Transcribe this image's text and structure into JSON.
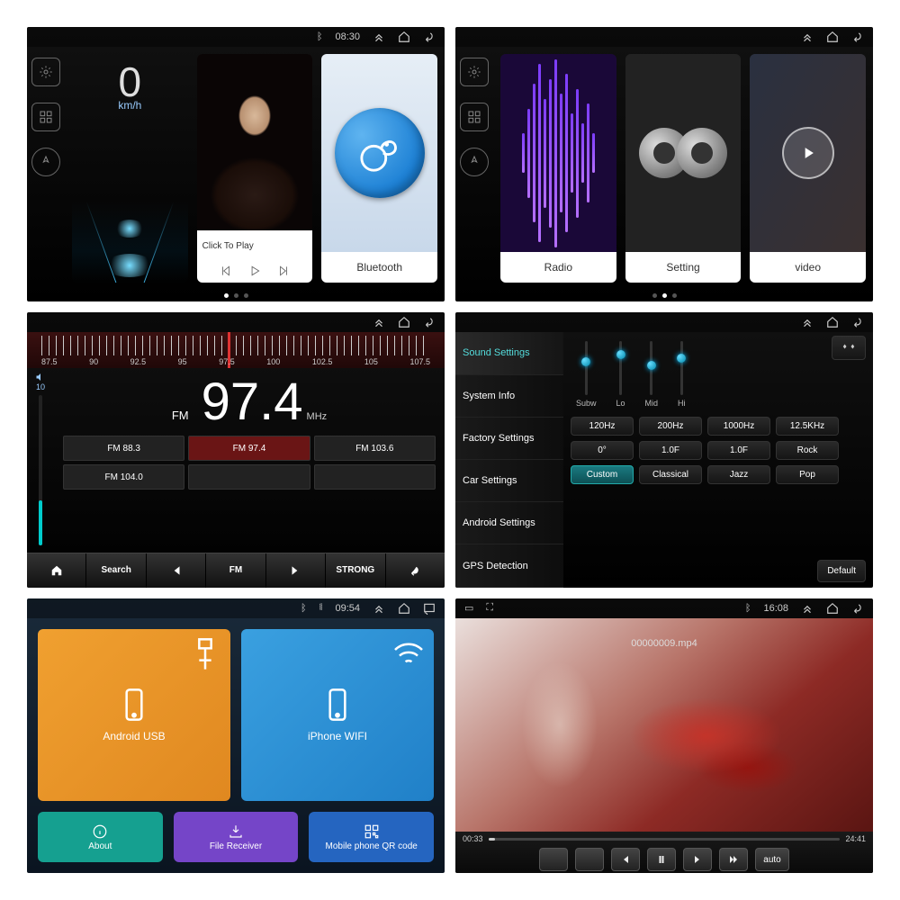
{
  "status": {
    "time1": "08:30",
    "time3": "09:54",
    "time6": "16:08"
  },
  "p1": {
    "speed": "0",
    "unit": "km/h",
    "music_label": "Click To Play",
    "bt_label": "Bluetooth"
  },
  "p2": {
    "radio": "Radio",
    "setting": "Setting",
    "video": "video"
  },
  "p3": {
    "ticks": [
      "87.5",
      "90",
      "92.5",
      "95",
      "97.5",
      "100",
      "102.5",
      "105",
      "107.5"
    ],
    "band": "FM",
    "freq": "97.4",
    "mhz": "MHz",
    "vol": "10",
    "presets": [
      "FM 88.3",
      "FM 97.4",
      "FM 103.6",
      "FM 104.0",
      "",
      ""
    ],
    "active_preset": 1,
    "bottom": [
      "",
      "Search",
      "",
      "FM",
      "",
      "STRONG",
      ""
    ],
    "search": "Search",
    "fm": "FM",
    "strong": "STRONG"
  },
  "p4": {
    "menu": [
      "Sound Settings",
      "System Info",
      "Factory Settings",
      "Car Settings",
      "Android Settings",
      "GPS Detection"
    ],
    "active_menu": 0,
    "sliders": [
      "Subw",
      "Lo",
      "Mid",
      "Hi"
    ],
    "row_hz": [
      "120Hz",
      "200Hz",
      "1000Hz",
      "12.5KHz"
    ],
    "row_deg": [
      "0°",
      "1.0F",
      "1.0F",
      "Rock"
    ],
    "row_preset": [
      "Custom",
      "Classical",
      "Jazz",
      "Pop"
    ],
    "active_preset": 0,
    "default": "Default"
  },
  "p5": {
    "android": "Android USB",
    "iphone": "iPhone WIFI",
    "about": "About",
    "file": "File Receiver",
    "qr": "Mobile phone QR code"
  },
  "p6": {
    "file": "00000009.mp4",
    "pos": "00:33",
    "dur": "24:41",
    "auto": "auto"
  }
}
